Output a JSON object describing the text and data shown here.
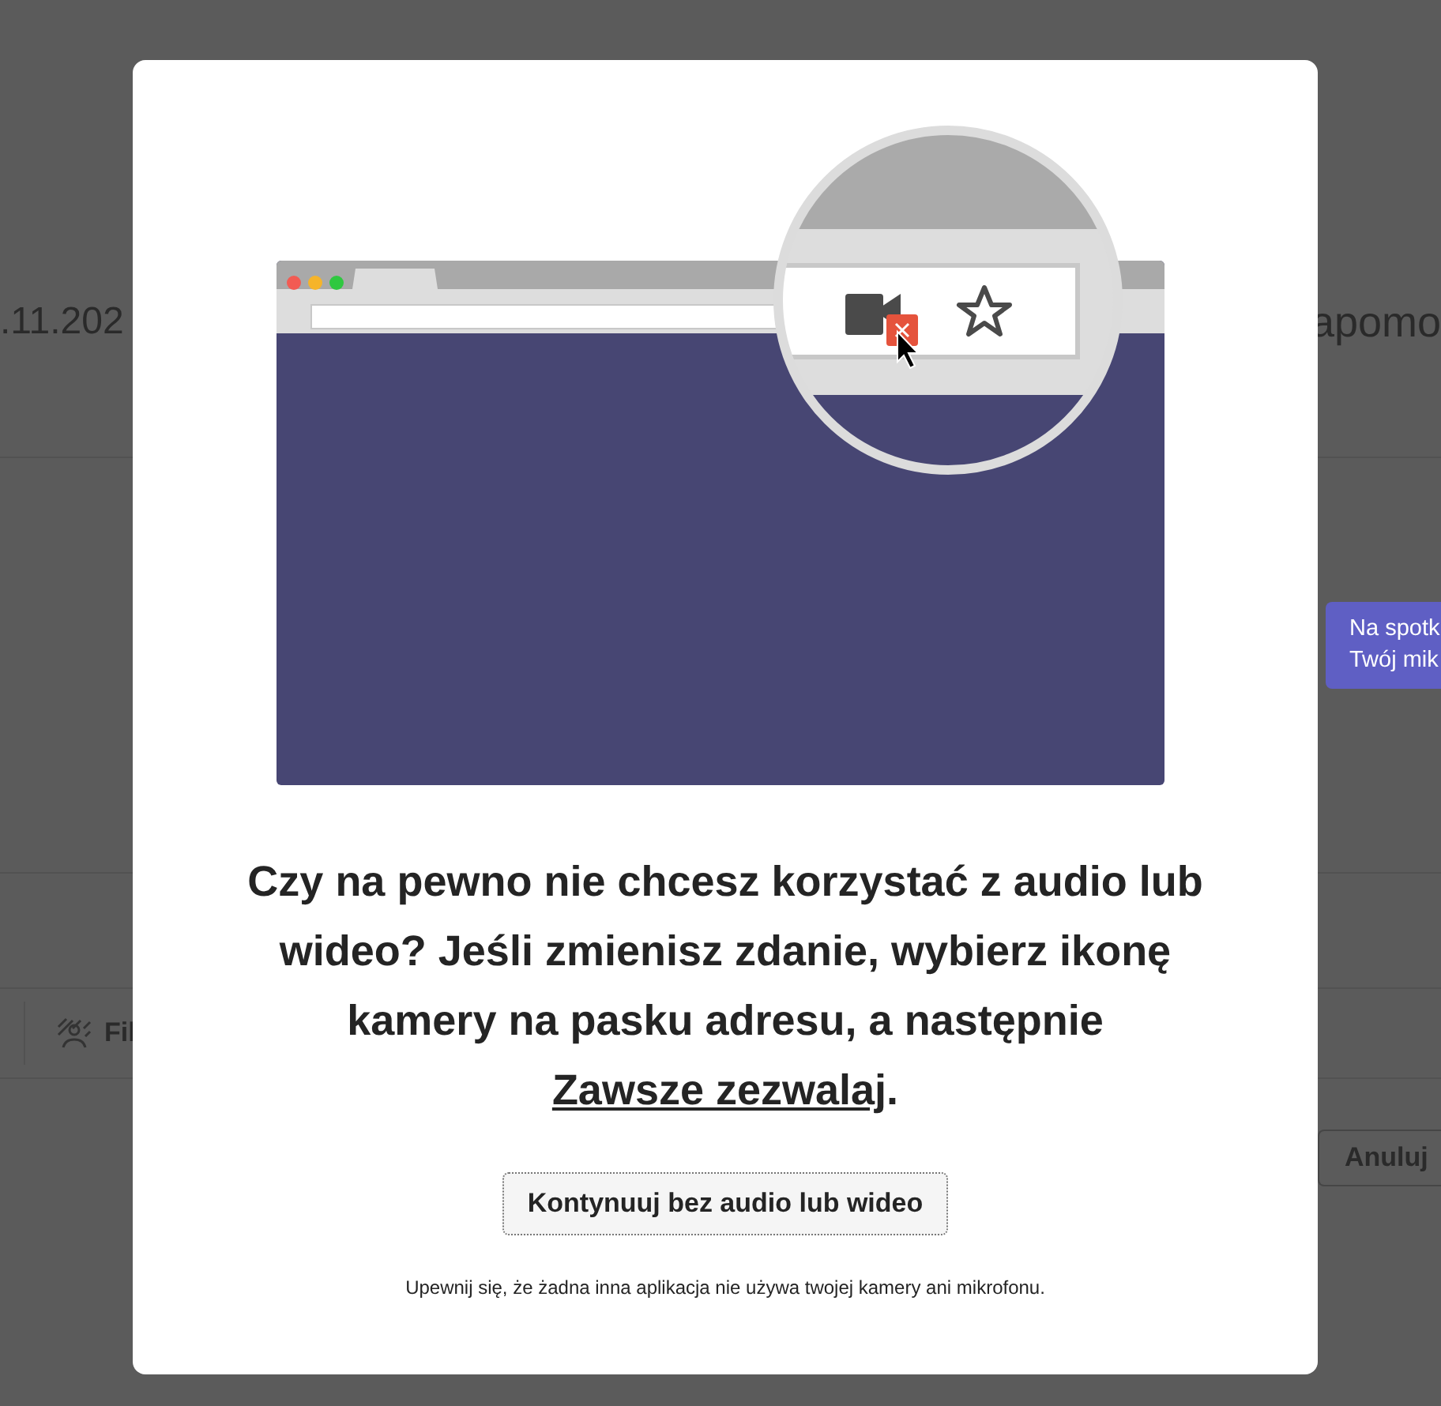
{
  "background": {
    "date_text": ".11.202",
    "header_right_text": "apomo",
    "filter_button": "Fil",
    "cancel_button": "Anuluj",
    "tooltip": {
      "lines": [
        "Na spotk",
        "Twój mik"
      ]
    }
  },
  "dialog": {
    "message": "Czy na pewno nie chcesz korzystać z audio lub wideo? Jeśli zmienisz zdanie, wybierz ikonę kamery na pasku adresu, a następnie ",
    "message_link": "Zawsze zezwalaj",
    "message_end": ".",
    "continue_button": "Kontynuuj bez audio lub wideo",
    "footnote": "Upewnij się, że żadna inna aplikacja nie używa twojej kamery ani mikrofonu."
  }
}
